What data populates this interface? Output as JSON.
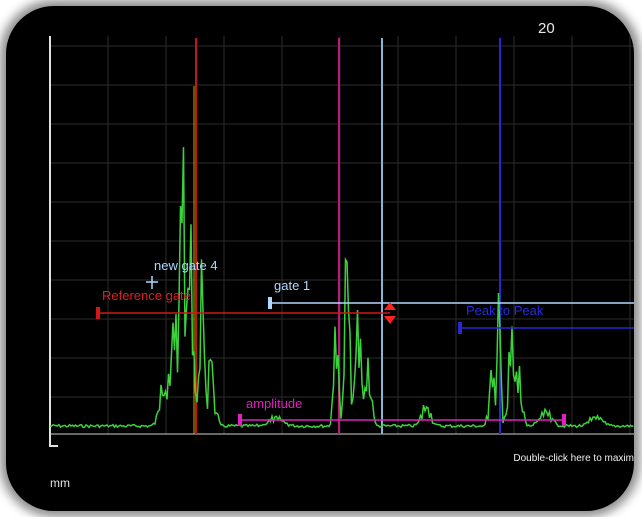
{
  "header": {
    "top_right_value": "20"
  },
  "footer": {
    "maximize_hint": "Double-click here to maxim",
    "unit_label": "mm"
  },
  "gates": [
    {
      "label": "new gate 4",
      "color": "#a8d8ff"
    },
    {
      "label": "gate 1",
      "color": "#b0d8ff"
    },
    {
      "label": "Reference gate",
      "color": "#e02020"
    },
    {
      "label": "Peak to Peak",
      "color": "#2020e0"
    },
    {
      "label": "amplitude",
      "color": "#e020c0"
    }
  ],
  "colors": {
    "signal": "#3cd23c",
    "grid": "#2c2c2c",
    "axis": "#e0e0e0",
    "cursor_red": "#c01818",
    "cursor_magenta": "#c0187a",
    "cursor_lightblue": "#8ab6d6",
    "cursor_blue": "#2828d0",
    "cursor_orange": "#e0a000"
  }
}
